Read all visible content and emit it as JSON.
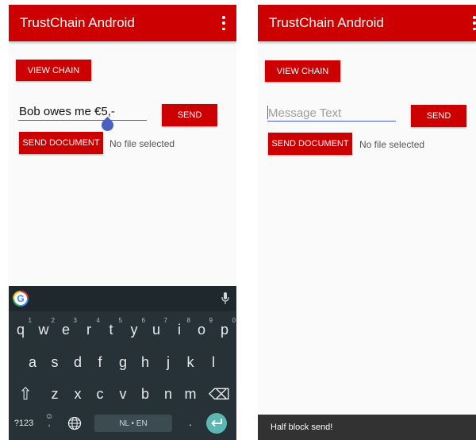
{
  "app_title": "TrustChain Android",
  "view_chain_label": "VIEW CHAIN",
  "send_label": "SEND",
  "send_document_label": "SEND DOCUMENT",
  "no_file_text": "No file selected",
  "left": {
    "message_value": "Bob owes me €5,-"
  },
  "right": {
    "message_placeholder": "Message Text",
    "snackbar_text": "Half block send!"
  },
  "keyboard": {
    "row1": [
      {
        "k": "q",
        "n": "1"
      },
      {
        "k": "w",
        "n": "2"
      },
      {
        "k": "e",
        "n": "3"
      },
      {
        "k": "r",
        "n": "4"
      },
      {
        "k": "t",
        "n": "5"
      },
      {
        "k": "y",
        "n": "6"
      },
      {
        "k": "u",
        "n": "7"
      },
      {
        "k": "i",
        "n": "8"
      },
      {
        "k": "o",
        "n": "9"
      },
      {
        "k": "p",
        "n": "0"
      }
    ],
    "row2": [
      "a",
      "s",
      "d",
      "f",
      "g",
      "h",
      "j",
      "k",
      "l"
    ],
    "row3": [
      "z",
      "x",
      "c",
      "v",
      "b",
      "n",
      "m"
    ],
    "symbols_label": "?123",
    "comma_label": ",",
    "emoji_label": "☺",
    "space_label": "NL • EN",
    "period_label": ".",
    "shift_glyph": "⇧",
    "backspace_glyph": "⌫"
  }
}
